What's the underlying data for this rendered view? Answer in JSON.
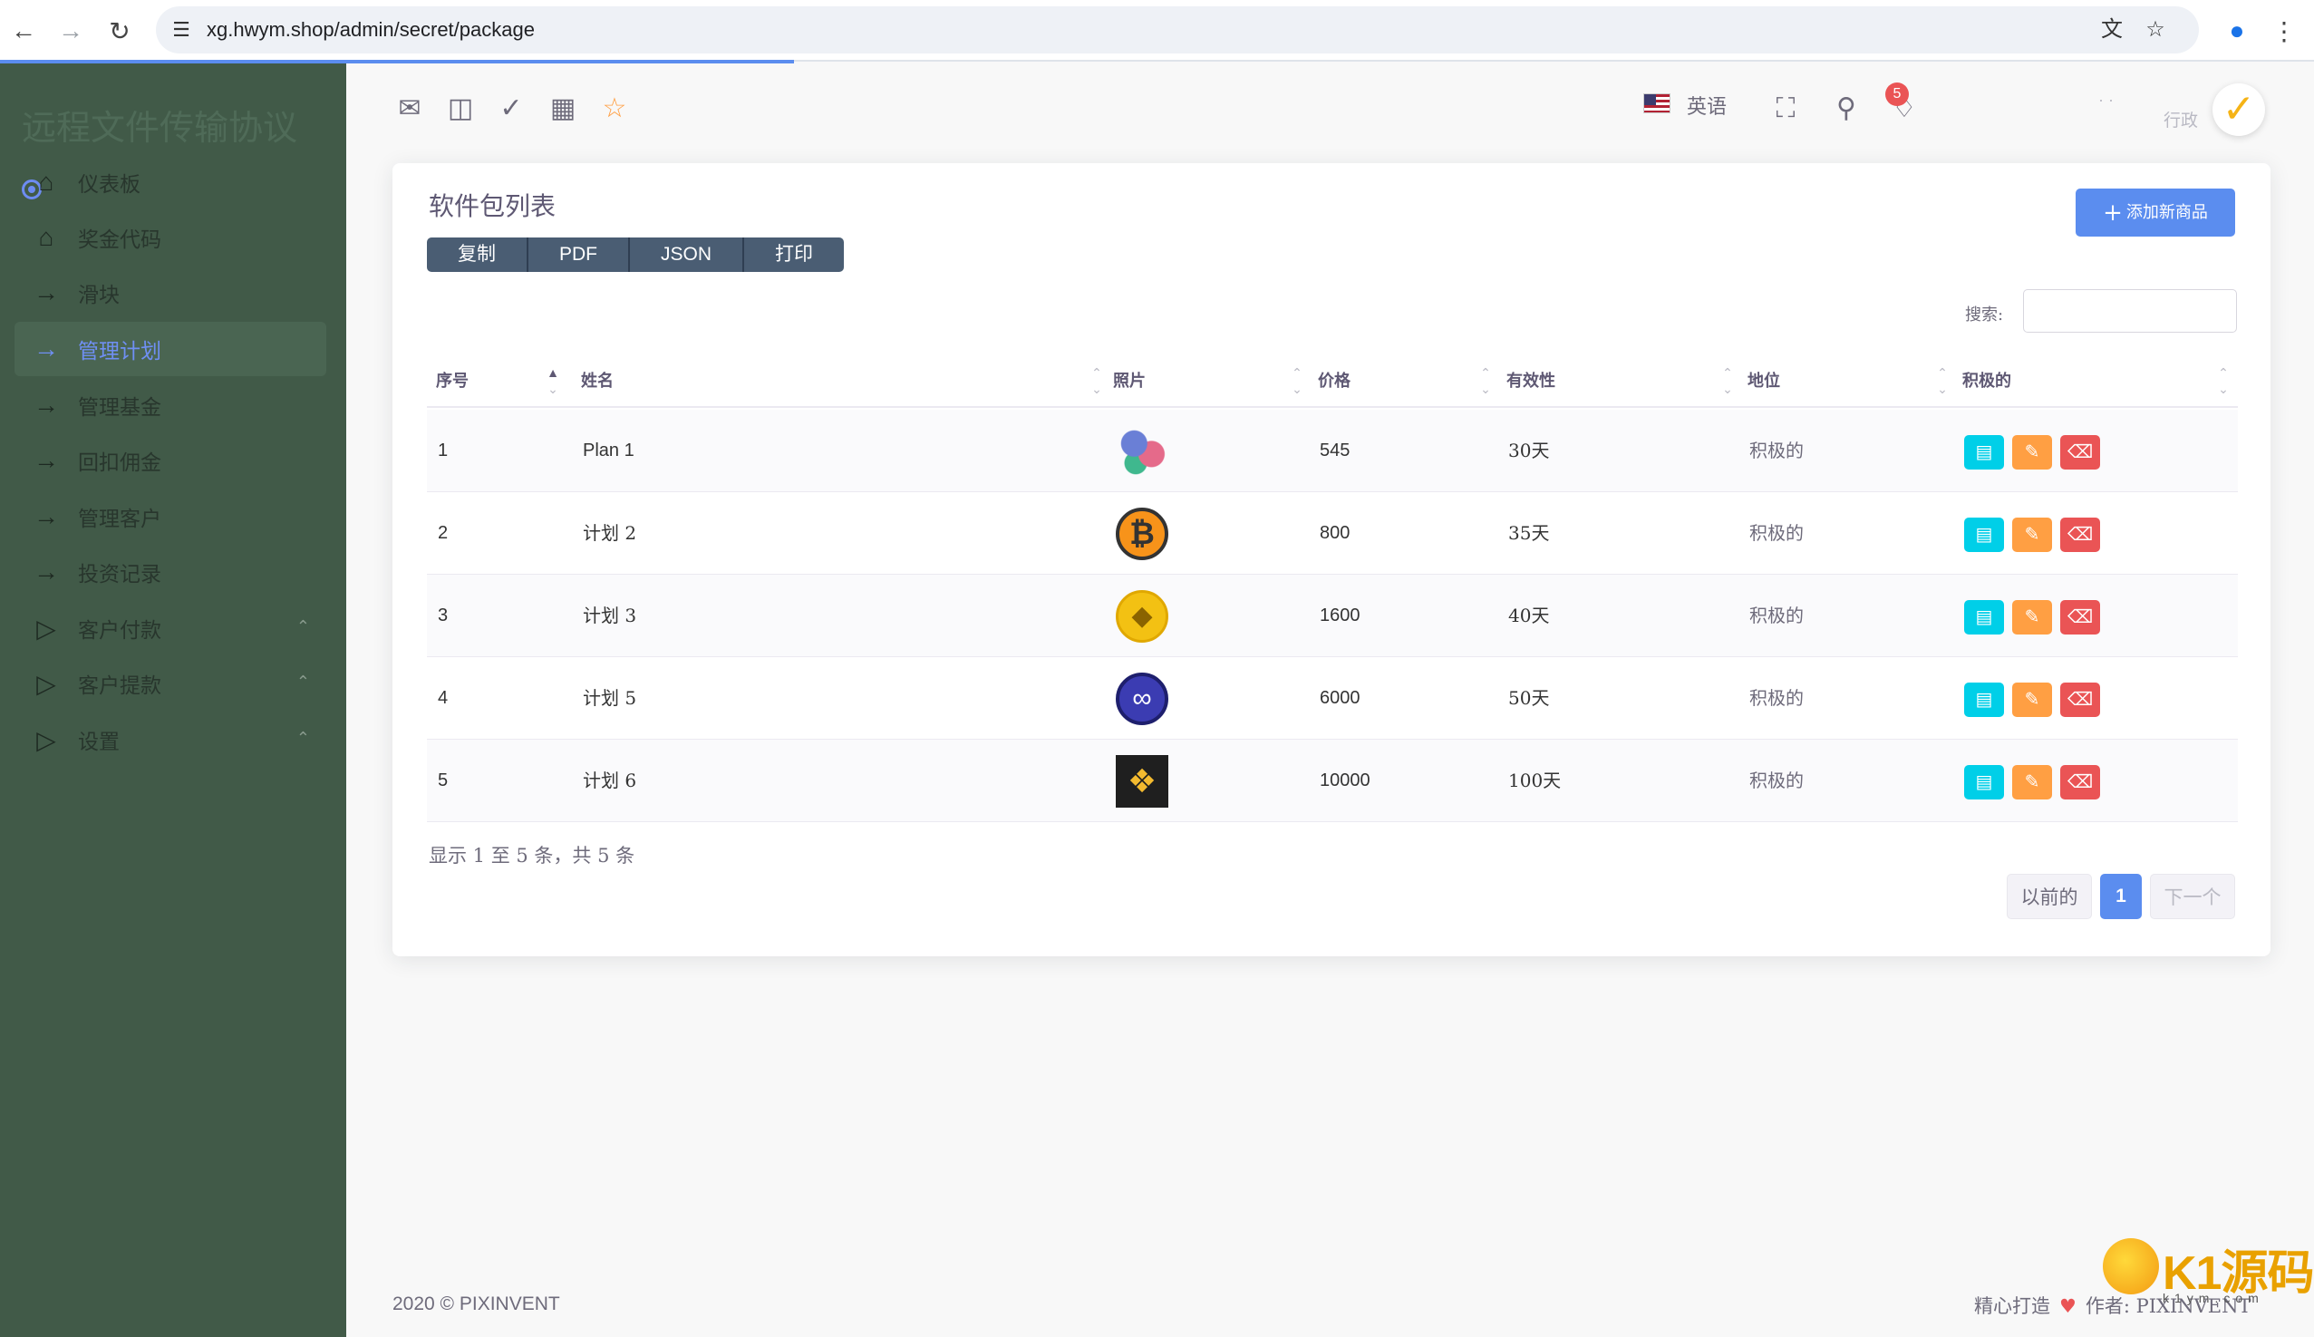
{
  "browser": {
    "url": "xg.hwym.shop/admin/secret/package"
  },
  "sidebar": {
    "brand": "远程文件传输协议",
    "items": [
      {
        "label": "仪表板",
        "icon": "home-icon",
        "active": false,
        "expandable": false
      },
      {
        "label": "奖金代码",
        "icon": "home-icon",
        "active": false,
        "expandable": false
      },
      {
        "label": "滑块",
        "icon": "arrow-right-icon",
        "active": false,
        "expandable": false
      },
      {
        "label": "管理计划",
        "icon": "arrow-right-icon",
        "active": true,
        "expandable": false
      },
      {
        "label": "管理基金",
        "icon": "arrow-right-icon",
        "active": false,
        "expandable": false
      },
      {
        "label": "回扣佣金",
        "icon": "arrow-right-icon",
        "active": false,
        "expandable": false
      },
      {
        "label": "管理客户",
        "icon": "arrow-right-icon",
        "active": false,
        "expandable": false
      },
      {
        "label": "投资记录",
        "icon": "arrow-right-icon",
        "active": false,
        "expandable": false
      },
      {
        "label": "客户付款",
        "icon": "play-icon",
        "active": false,
        "expandable": true
      },
      {
        "label": "客户提款",
        "icon": "play-icon",
        "active": false,
        "expandable": true
      },
      {
        "label": "设置",
        "icon": "play-icon",
        "active": false,
        "expandable": true
      }
    ]
  },
  "topbar": {
    "language": "英语",
    "notification_count": "5",
    "user_name": "· ·",
    "user_role": "行政"
  },
  "card": {
    "title": "软件包列表",
    "export_buttons": [
      "复制",
      "PDF",
      "JSON",
      "打印"
    ],
    "add_button": "添加新商品",
    "search_label": "搜索:",
    "search_value": "",
    "columns": [
      "序号",
      "姓名",
      "照片",
      "价格",
      "有效性",
      "地位",
      "积极的"
    ],
    "rows": [
      {
        "id": "1",
        "name": "Plan 1",
        "photo": "polkadot-coin",
        "price": "545",
        "validity": "30天",
        "status": "积极的"
      },
      {
        "id": "2",
        "name": "计划 2",
        "photo": "bitcoin-coin",
        "price": "800",
        "validity": "35天",
        "status": "积极的"
      },
      {
        "id": "3",
        "name": "计划 3",
        "photo": "ethereum-coin",
        "price": "1600",
        "validity": "40天",
        "status": "积极的"
      },
      {
        "id": "4",
        "name": "计划 5",
        "photo": "polygon-coin",
        "price": "6000",
        "validity": "50天",
        "status": "积极的"
      },
      {
        "id": "5",
        "name": "计划 6",
        "photo": "bnb-coin",
        "price": "10000",
        "validity": "100天",
        "status": "积极的"
      }
    ],
    "info": "显示 1 至 5 条，共 5 条",
    "pagination": {
      "prev": "以前的",
      "current": "1",
      "next": "下一个"
    }
  },
  "footer": {
    "copyright": "2020 © PIXINVENT",
    "made_with": "精心打造",
    "author_label": "作者:",
    "author": "PIXINVENT"
  },
  "watermark": {
    "text": "K1源码",
    "sub": "k1ym.com"
  },
  "colors": {
    "sidebar_bg": "#415a48",
    "primary": "#5b8def",
    "info": "#00cfe8",
    "warning": "#ff9f43",
    "danger": "#ea5455"
  }
}
